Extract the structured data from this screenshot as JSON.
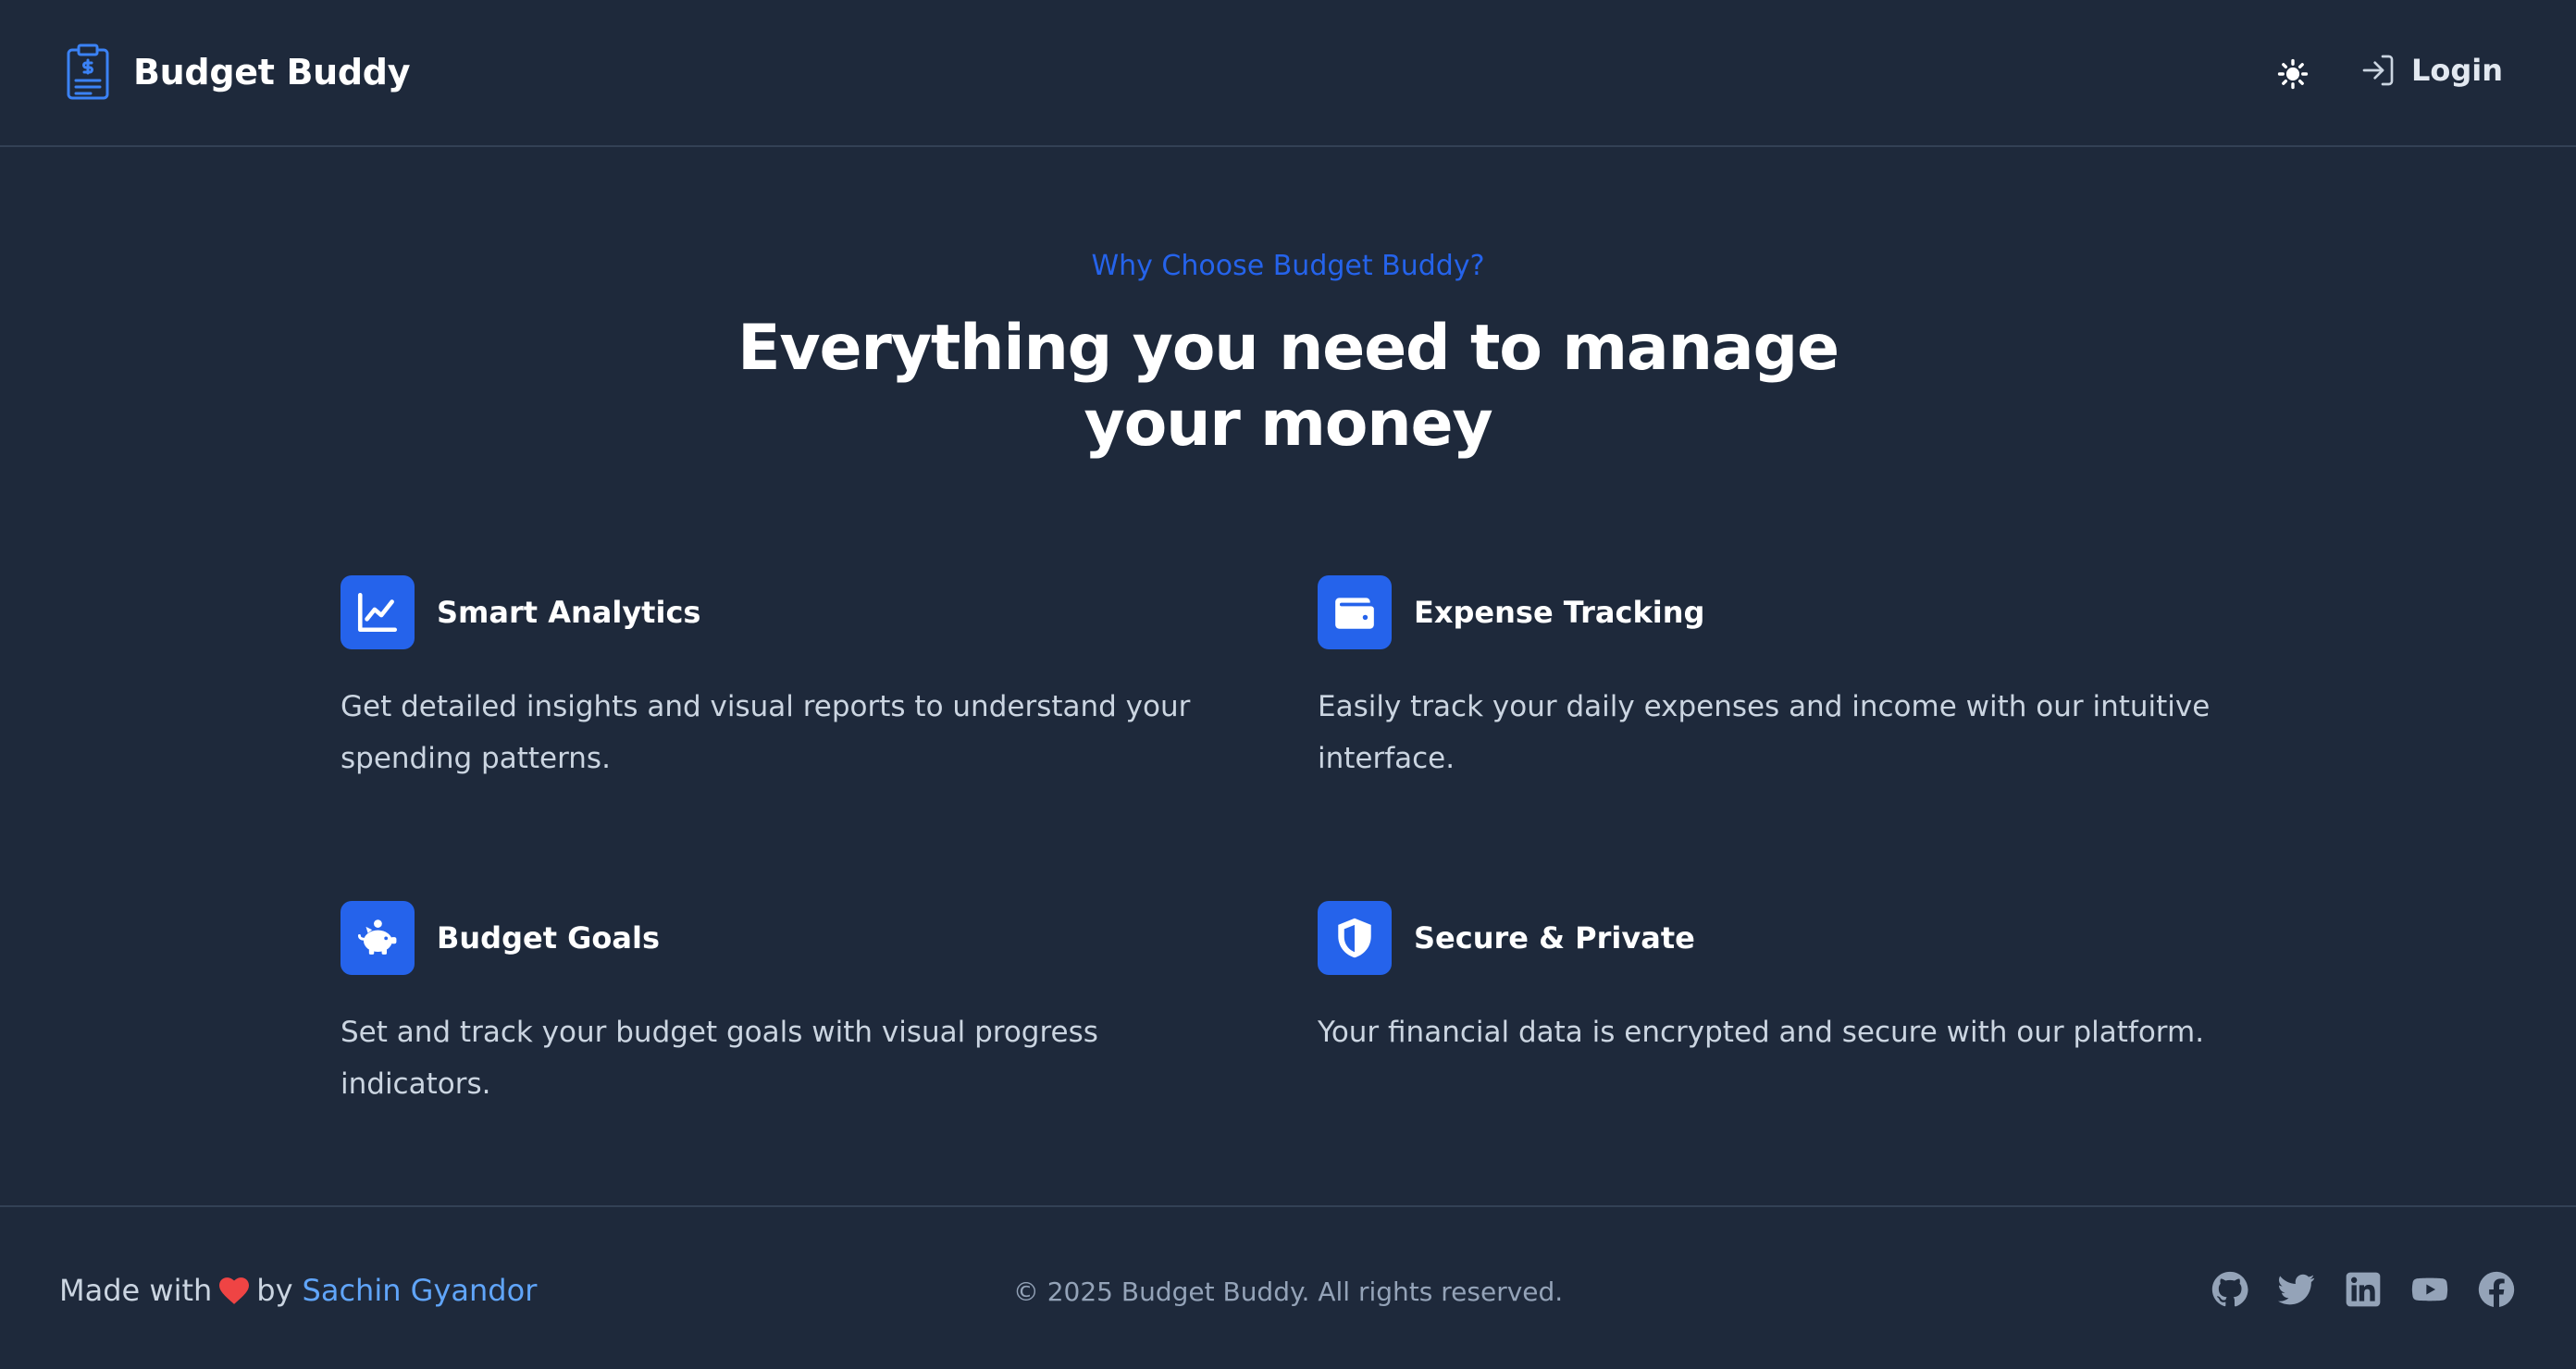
{
  "header": {
    "brand_name": "Budget Buddy",
    "brand_icon": "clipboard-dollar-icon",
    "theme_toggle_icon": "sun-icon",
    "login_icon": "login-arrow-icon",
    "login_label": "Login"
  },
  "hero": {
    "eyebrow": "Why Choose Budget Buddy?",
    "headline": "Everything you need to manage your money"
  },
  "features": [
    {
      "icon": "chart-line-icon",
      "title": "Smart Analytics",
      "description": "Get detailed insights and visual reports to understand your spending patterns."
    },
    {
      "icon": "wallet-icon",
      "title": "Expense Tracking",
      "description": "Easily track your daily expenses and income with our intuitive interface."
    },
    {
      "icon": "piggy-bank-icon",
      "title": "Budget Goals",
      "description": "Set and track your budget goals with visual progress indicators."
    },
    {
      "icon": "shield-icon",
      "title": "Secure & Private",
      "description": "Your financial data is encrypted and secure with our platform."
    }
  ],
  "footer": {
    "made_with_prefix": "Made with",
    "heart_icon": "heart-icon",
    "by_text": "by",
    "author_name": "Sachin Gyandor",
    "copyright": "© 2025 Budget Buddy. All rights reserved.",
    "socials": [
      "github-icon",
      "twitter-icon",
      "linkedin-icon",
      "youtube-icon",
      "facebook-icon"
    ]
  },
  "colors": {
    "background": "#1e293b",
    "accent": "#2563eb",
    "link": "#60a5fa",
    "heart": "#ef4444",
    "border": "#334155",
    "muted_text": "#cbd5e1",
    "social_icon": "#94a3b8"
  }
}
